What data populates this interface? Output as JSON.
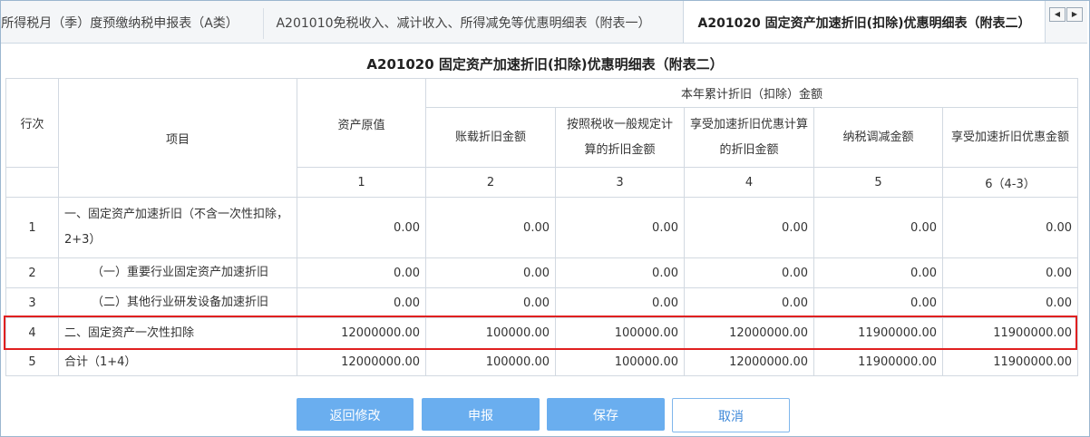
{
  "tabs": [
    {
      "label": "所得税月（季）度预缴纳税申报表（A类）"
    },
    {
      "label": "A201010免税收入、减计收入、所得减免等优惠明细表（附表一）"
    },
    {
      "label": "A201020 固定资产加速折旧(扣除)优惠明细表（附表二）"
    }
  ],
  "tab_nav": {
    "prev_icon": "◀",
    "next_icon": "▶"
  },
  "page_title": "A201020 固定资产加速折旧(扣除)优惠明细表（附表二）",
  "table": {
    "headers": {
      "row_no": "行次",
      "item": "项目",
      "asset_value": "资产原值",
      "group": "本年累计折旧（扣除）金额",
      "col2": "账载折旧金额",
      "col3": "按照税收一般规定计算的折旧金额",
      "col4": "享受加速折旧优惠计算的折旧金额",
      "col5": "纳税调减金额",
      "col6": "享受加速折旧优惠金额"
    },
    "col_numbers": [
      "1",
      "2",
      "3",
      "4",
      "5",
      "6（4-3）"
    ],
    "rows": [
      {
        "no": "1",
        "item": "一、固定资产加速折旧（不含一次性扣除，2+3）",
        "values": [
          "0.00",
          "0.00",
          "0.00",
          "0.00",
          "0.00",
          "0.00"
        ]
      },
      {
        "no": "2",
        "item": "（一）重要行业固定资产加速折旧",
        "values": [
          "0.00",
          "0.00",
          "0.00",
          "0.00",
          "0.00",
          "0.00"
        ]
      },
      {
        "no": "3",
        "item": "（二）其他行业研发设备加速折旧",
        "values": [
          "0.00",
          "0.00",
          "0.00",
          "0.00",
          "0.00",
          "0.00"
        ]
      },
      {
        "no": "4",
        "item": "二、固定资产一次性扣除",
        "values": [
          "12000000.00",
          "100000.00",
          "100000.00",
          "12000000.00",
          "11900000.00",
          "11900000.00"
        ]
      },
      {
        "no": "5",
        "item": "合计（1+4）",
        "values": [
          "12000000.00",
          "100000.00",
          "100000.00",
          "12000000.00",
          "11900000.00",
          "11900000.00"
        ]
      }
    ]
  },
  "buttons": {
    "back": "返回修改",
    "declare": "申报",
    "save": "保存",
    "cancel": "取消"
  }
}
